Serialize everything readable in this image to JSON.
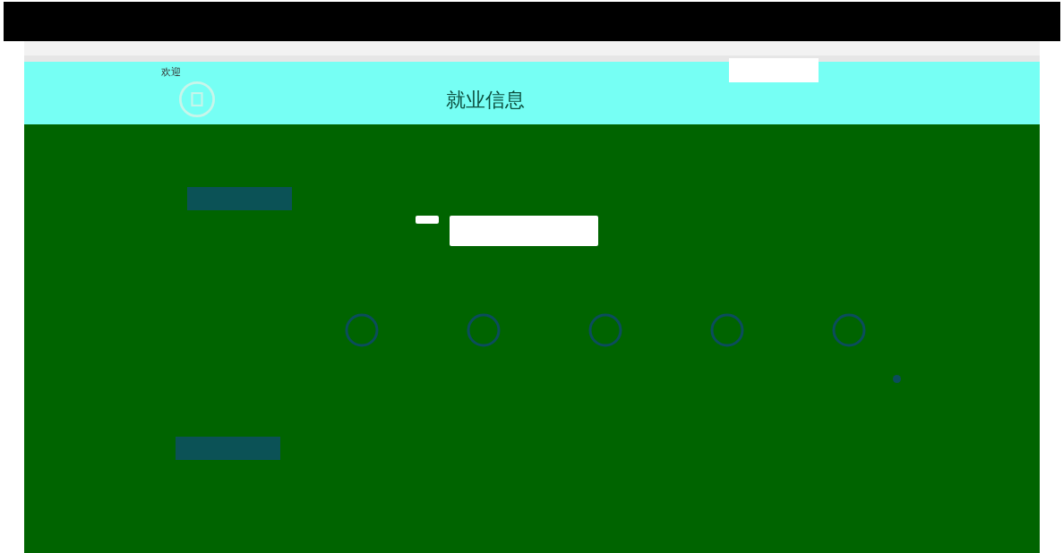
{
  "header": {
    "welcome": "欢迎",
    "site_name": "就业信息"
  },
  "feature_icons": [
    {
      "kind": "circle"
    },
    {
      "kind": "circle"
    },
    {
      "kind": "circle"
    },
    {
      "kind": "circle"
    },
    {
      "kind": "circle"
    }
  ]
}
